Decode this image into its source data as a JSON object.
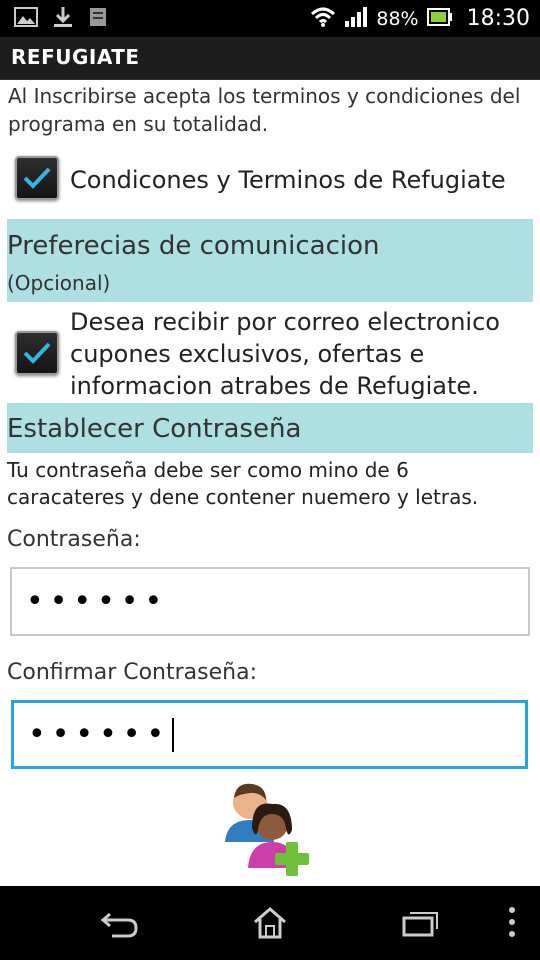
{
  "status_bar": {
    "battery_percent": "88%",
    "time": "18:30",
    "icons": [
      "image-notification-icon",
      "download-icon",
      "notes-icon",
      "wifi-icon",
      "signal-icon",
      "battery-icon"
    ]
  },
  "action_bar": {
    "title": "REFUGIATE"
  },
  "terms": {
    "text": "Al Inscribirse acepta los terminos y condiciones del programa en su totalidad.",
    "checkbox_label": "Condicones y Terminos de Refugiate",
    "checked": true
  },
  "communication": {
    "title": "Preferecias de comunicacion",
    "subtitle": "(Opcional)",
    "checkbox_label": "Desea recibir por correo electronico cupones exclusivos, ofertas e informacion atrabes de Refugiate.",
    "checked": true
  },
  "password_section": {
    "title": "Establecer Contraseña",
    "description": "Tu contraseña debe ser como mino de 6 caracateres y dene contener nuemero y letras.",
    "password_label": "Contraseña:",
    "password_value": "••••••",
    "confirm_label": "Confirmar Contraseña:",
    "confirm_value": "••••••"
  },
  "colors": {
    "section_band": "#aedfe3",
    "active_input_border": "#2aa3d8",
    "check_color": "#33b5e5"
  },
  "nav_bar": {
    "icons": [
      "back-icon",
      "home-icon",
      "recent-apps-icon",
      "menu-icon"
    ]
  }
}
